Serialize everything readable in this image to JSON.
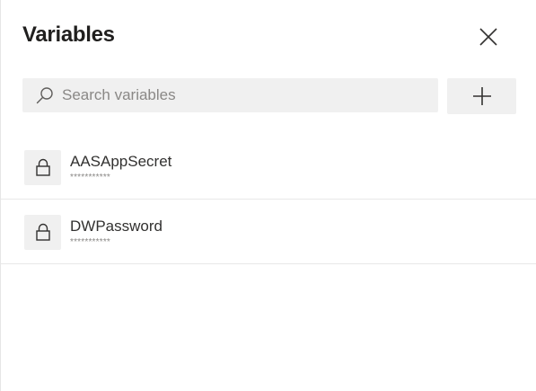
{
  "panel": {
    "title": "Variables"
  },
  "search": {
    "placeholder": "Search variables",
    "value": ""
  },
  "icons": {
    "close": "close-icon",
    "search": "search-icon",
    "add": "plus-icon",
    "lock": "lock-icon"
  },
  "variables": [
    {
      "name": "AASAppSecret",
      "value": "***********",
      "secret": true
    },
    {
      "name": "DWPassword",
      "value": "***********",
      "secret": true
    }
  ]
}
